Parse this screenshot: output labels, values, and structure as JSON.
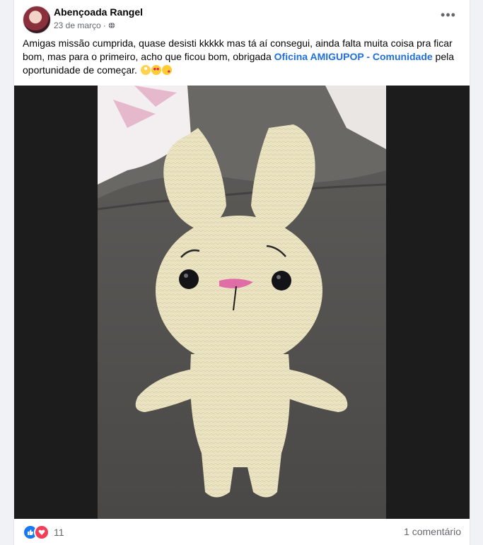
{
  "post": {
    "author": "Abençoada Rangel",
    "date": "23 de março",
    "separator": "·",
    "privacy_icon": "globe-icon",
    "more_icon": "more-options-icon",
    "text_before_link": "Amigas missão cumprida, quase desisti kkkkk mas tá aí consegui, ainda falta muita coisa pra ficar bom, mas  para o primeiro, acho que ficou bom, obrigada ",
    "link_text": "Oficina AMIGUPOP - Comunidade",
    "text_after_link": "  pela oportunidade de começar.",
    "emojis": [
      "rolling-eyes-emoji",
      "heart-eyes-emoji",
      "kissing-emoji"
    ],
    "image_alt": "Coelho de amigurumi de crochê na cor creme sentado em um sofá cinza"
  },
  "footer": {
    "reaction_icons": [
      "like-icon",
      "love-icon"
    ],
    "reaction_count": "11",
    "comments_label": "1 comentário"
  },
  "colors": {
    "link": "#216fdb",
    "secondary_text": "#65676b",
    "like": "#1877f2",
    "love": "#f33e58",
    "yarn": "#efe8c8"
  }
}
